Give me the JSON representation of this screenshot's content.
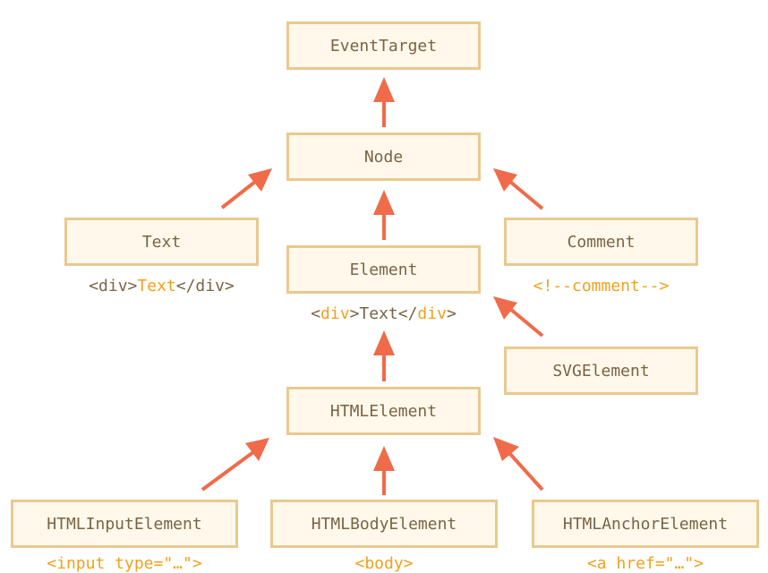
{
  "nodes": {
    "eventtarget": {
      "label": "EventTarget"
    },
    "node": {
      "label": "Node"
    },
    "text": {
      "label": "Text"
    },
    "element": {
      "label": "Element"
    },
    "comment": {
      "label": "Comment"
    },
    "svgelement": {
      "label": "SVGElement"
    },
    "htmlelement": {
      "label": "HTMLElement"
    },
    "htmlinputelement": {
      "label": "HTMLInputElement"
    },
    "htmlbodyelement": {
      "label": "HTMLBodyElement"
    },
    "htmlanchorelement": {
      "label": "HTMLAnchorElement"
    }
  },
  "captions": {
    "text": {
      "pre": "<div>",
      "hl": "Text",
      "post": "</div>"
    },
    "element": {
      "p1": "<",
      "h1": "div",
      "p2": ">Text</",
      "h2": "div",
      "p3": ">"
    },
    "comment": "<!--comment-->",
    "htmlinputelement": "<input type=\"…\">",
    "htmlbodyelement": "<body>",
    "htmlanchorelement": "<a href=\"…\">"
  },
  "edges": [
    {
      "from": "Node",
      "to": "EventTarget"
    },
    {
      "from": "Text",
      "to": "Node"
    },
    {
      "from": "Element",
      "to": "Node"
    },
    {
      "from": "Comment",
      "to": "Node"
    },
    {
      "from": "SVGElement",
      "to": "Element"
    },
    {
      "from": "HTMLElement",
      "to": "Element"
    },
    {
      "from": "HTMLInputElement",
      "to": "HTMLElement"
    },
    {
      "from": "HTMLBodyElement",
      "to": "HTMLElement"
    },
    {
      "from": "HTMLAnchorElement",
      "to": "HTMLElement"
    }
  ],
  "colors": {
    "arrow": "#ef6b4a",
    "box_fill": "#fff8eb",
    "box_border": "#e9c98f",
    "text": "#7a6444",
    "highlight": "#f0a11d"
  }
}
